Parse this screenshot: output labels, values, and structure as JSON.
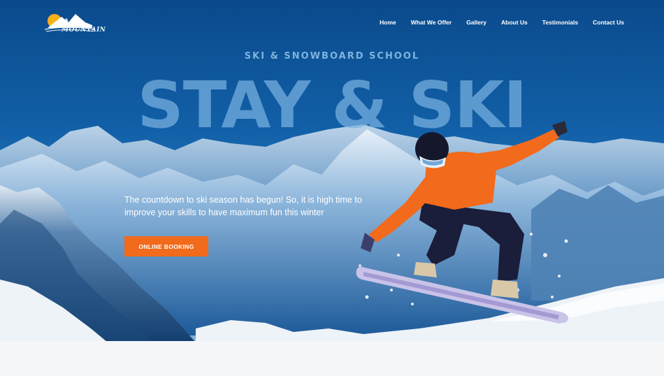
{
  "brand": {
    "logo_text": "MOUNTAIN"
  },
  "nav": {
    "items": [
      {
        "label": "Home"
      },
      {
        "label": "What We Offer"
      },
      {
        "label": "Gallery"
      },
      {
        "label": "About Us"
      },
      {
        "label": "Testimonials"
      },
      {
        "label": "Contact Us"
      }
    ]
  },
  "hero": {
    "subtitle": "SKI & SNOWBOARD SCHOOL",
    "headline": "STAY & SKI",
    "tagline": "The countdown to ski season has begun! So, it is high time to improve your skills to have maximum fun this winter",
    "cta_label": "ONLINE BOOKING"
  },
  "colors": {
    "sky": "#0b4d8f",
    "accent": "#f26a1b",
    "headline": "#78b2e0",
    "subtitle": "#7eb3dd",
    "jacket": "#f26a1b"
  }
}
